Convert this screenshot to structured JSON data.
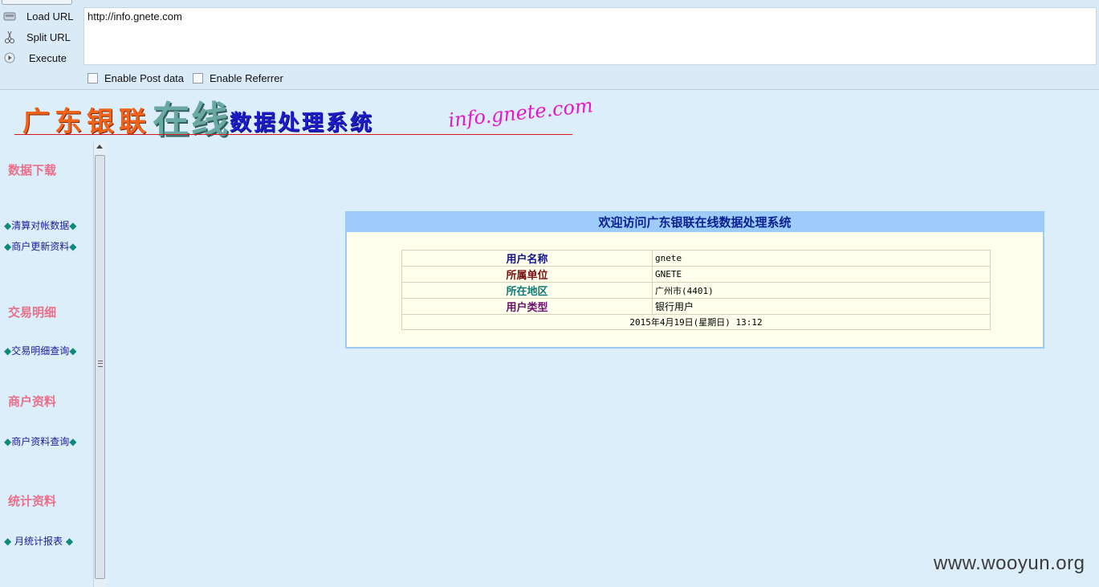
{
  "hackbar": {
    "commands": [
      {
        "label": "Load URL",
        "icon": "load-url-icon"
      },
      {
        "label": "Split URL",
        "icon": "split-url-icon"
      },
      {
        "label": "Execute",
        "icon": "execute-icon"
      }
    ],
    "url": "http://info.gnete.com",
    "options": [
      {
        "label": "Enable Post data",
        "checked": false
      },
      {
        "label": "Enable Referrer",
        "checked": false
      }
    ]
  },
  "banner": {
    "part1": "广东银联",
    "part2": "在线",
    "part3": "数据处理系统",
    "part4": "info.gnete.com"
  },
  "menu": {
    "sections": [
      {
        "title": "数据下载",
        "links": [
          "◆清算对帐数据◆",
          "◆商户更新资料◆"
        ]
      },
      {
        "title": "交易明细",
        "links": [
          "◆交易明细查询◆"
        ]
      },
      {
        "title": "商户资料",
        "links": [
          "◆商户资料查询◆"
        ]
      },
      {
        "title": "统计资料",
        "links": [
          "◆ 月统计报表 ◆"
        ]
      }
    ]
  },
  "welcome": {
    "title": "欢迎访问广东银联在线数据处理系统",
    "rows": [
      {
        "label": "用户名称",
        "value": "gnete",
        "color": "#12128a"
      },
      {
        "label": "所属单位",
        "value": "GNETE",
        "color": "#7a1010"
      },
      {
        "label": "所在地区",
        "value": "广州市(4401)",
        "color": "#0b7a72"
      },
      {
        "label": "用户类型",
        "value": "银行用户",
        "color": "#6a0f6a"
      }
    ],
    "datetime": "2015年4月19日(星期日) 13:12"
  },
  "watermark": "www.wooyun.org",
  "colors": {
    "page_bg": "#ddeefb",
    "toolbar_bg": "#dbeaf7",
    "section_title": "#e8708a",
    "menu_link": "#1a1a9a",
    "diamond": "#0f8a7a",
    "welcome_head_bg": "#9dccfa",
    "welcome_body_bg": "#ffffee"
  }
}
